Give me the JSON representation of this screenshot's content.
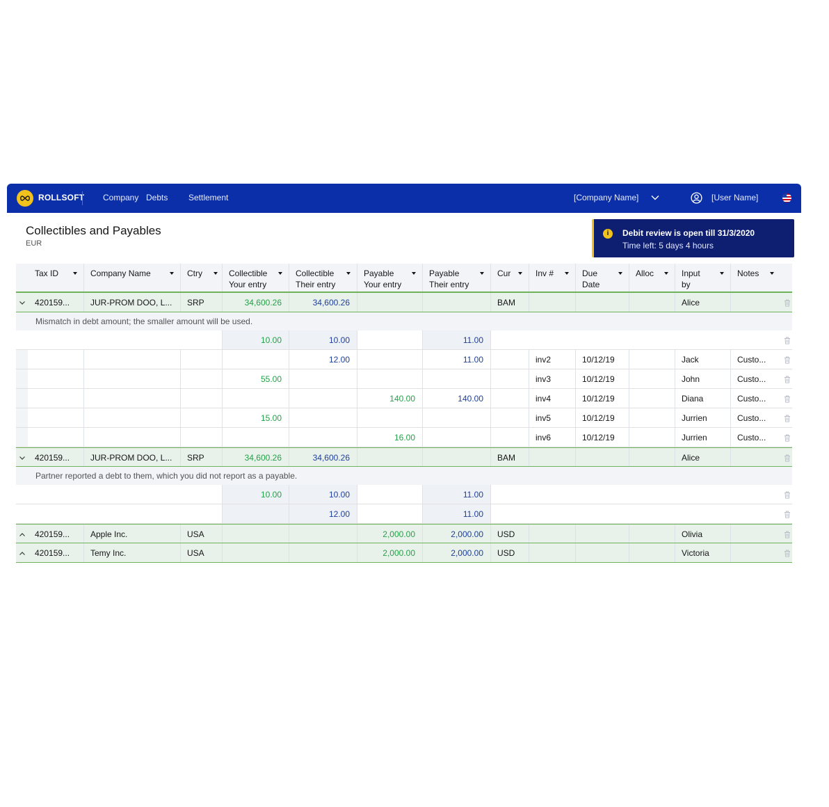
{
  "brand": {
    "name": "ROLLSOFT",
    "logo_icon": "infinity-loop-icon",
    "accent": "#f1c21b",
    "nav_bg": "#0b2fa8"
  },
  "nav": {
    "items": [
      "Company",
      "Debts",
      "Settlement"
    ]
  },
  "header": {
    "company_select": "[Company Name]",
    "user_name": "[User Name]",
    "locale_flag": "us-flag-icon"
  },
  "page": {
    "title": "Collectibles and Payables",
    "subtitle": "EUR"
  },
  "notice": {
    "title": "Debit review is open till 31/3/2020",
    "subtitle": "Time left: 5 days 4 hours",
    "icon": "info-icon"
  },
  "table": {
    "columns": [
      {
        "line1": "Tax ID",
        "line2": ""
      },
      {
        "line1": "Company Name",
        "line2": ""
      },
      {
        "line1": "Ctry",
        "line2": ""
      },
      {
        "line1": "Collectible",
        "line2": "Your entry"
      },
      {
        "line1": "Collectible",
        "line2": "Their entry"
      },
      {
        "line1": "Payable",
        "line2": "Your entry"
      },
      {
        "line1": "Payable",
        "line2": "Their entry"
      },
      {
        "line1": "Cur",
        "line2": ""
      },
      {
        "line1": "Inv #",
        "line2": ""
      },
      {
        "line1": "Due",
        "line2": "Date"
      },
      {
        "line1": "Alloc",
        "line2": ""
      },
      {
        "line1": "Input",
        "line2": "by"
      },
      {
        "line1": "Notes",
        "line2": ""
      }
    ],
    "rows": [
      {
        "kind": "parent",
        "expander": "chevron-down",
        "cells": [
          "420159...",
          "JUR-PROM DOO, L...",
          "SRP",
          "34,600.26",
          "34,600.26",
          "",
          "",
          "BAM",
          "",
          "",
          "",
          "Alice",
          ""
        ]
      },
      {
        "kind": "message",
        "text": "Mismatch in debt amount; the smaller amount will be used."
      },
      {
        "kind": "child-split",
        "cells": [
          "",
          "",
          "",
          "10.00",
          "10.00",
          "",
          "11.00",
          "",
          "",
          "",
          "",
          "",
          ""
        ]
      },
      {
        "kind": "child",
        "cells": [
          "",
          "",
          "",
          "",
          "12.00",
          "",
          "11.00",
          "",
          "inv2",
          "10/12/19",
          "",
          "Jack",
          "Custo..."
        ]
      },
      {
        "kind": "child",
        "cells": [
          "",
          "",
          "",
          "55.00",
          "",
          "",
          "",
          "",
          "inv3",
          "10/12/19",
          "",
          "John",
          "Custo..."
        ]
      },
      {
        "kind": "child",
        "cells": [
          "",
          "",
          "",
          "",
          "",
          "140.00",
          "140.00",
          "",
          "inv4",
          "10/12/19",
          "",
          "Diana",
          "Custo..."
        ]
      },
      {
        "kind": "child",
        "cells": [
          "",
          "",
          "",
          "15.00",
          "",
          "",
          "",
          "",
          "inv5",
          "10/12/19",
          "",
          "Jurrien",
          "Custo..."
        ]
      },
      {
        "kind": "child",
        "cells": [
          "",
          "",
          "",
          "",
          "",
          "16.00",
          "",
          "",
          "inv6",
          "10/12/19",
          "",
          "Jurrien",
          "Custo..."
        ]
      },
      {
        "kind": "parent",
        "expander": "chevron-down",
        "cells": [
          "420159...",
          "JUR-PROM DOO, L...",
          "SRP",
          "34,600.26",
          "34,600.26",
          "",
          "",
          "BAM",
          "",
          "",
          "",
          "Alice",
          ""
        ]
      },
      {
        "kind": "message",
        "text": "Partner reported a debt to them, which you did not report as a payable."
      },
      {
        "kind": "child-split",
        "cells": [
          "",
          "",
          "",
          "10.00",
          "10.00",
          "",
          "11.00",
          "",
          "",
          "",
          "",
          "",
          ""
        ]
      },
      {
        "kind": "child-split",
        "cells": [
          "",
          "",
          "",
          "",
          "12.00",
          "",
          "11.00",
          "",
          "",
          "",
          "",
          "",
          ""
        ]
      },
      {
        "kind": "parent",
        "expander": "chevron-up",
        "cells": [
          "420159...",
          "Apple Inc.",
          "USA",
          "",
          "",
          "2,000.00",
          "2,000.00",
          "USD",
          "",
          "",
          "",
          "Olivia",
          ""
        ]
      },
      {
        "kind": "parent",
        "expander": "chevron-up",
        "cells": [
          "420159...",
          "Temy Inc.",
          "USA",
          "",
          "",
          "2,000.00",
          "2,000.00",
          "USD",
          "",
          "",
          "",
          "Victoria",
          ""
        ]
      }
    ]
  },
  "colors": {
    "your_entry": "#24a148",
    "their_entry": "#1d3f9c",
    "row_group_border": "#6eb35a"
  }
}
